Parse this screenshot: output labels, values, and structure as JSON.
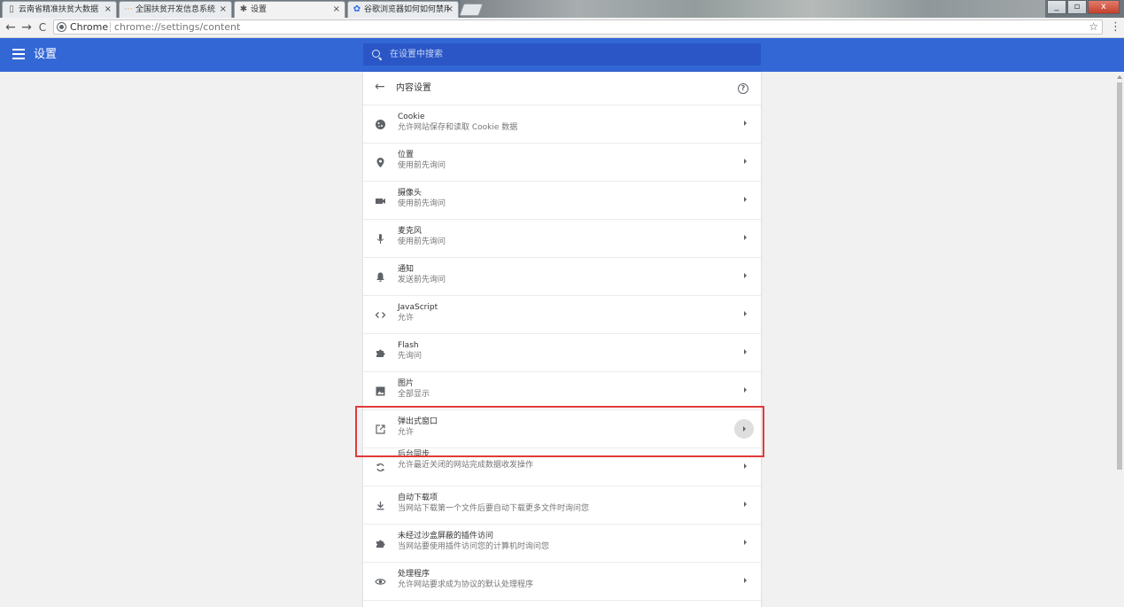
{
  "tabs": [
    {
      "title": "云南省精准扶贫大数据",
      "icon": "document-icon",
      "close": "×"
    },
    {
      "title": "全国扶贫开发信息系统",
      "icon": "page-icon",
      "close": "×"
    },
    {
      "title": "设置",
      "icon": "gear-icon",
      "close": "×"
    },
    {
      "title": "谷歌浏览器如何如何禁用",
      "icon": "baidu-icon",
      "close": "×"
    }
  ],
  "window_controls": {
    "minimize": "_",
    "restore": "▫",
    "close": "x"
  },
  "toolbar": {
    "back": "←",
    "forward": "→",
    "reload": "C",
    "origin_chip": "Chrome",
    "url": "chrome://settings/content",
    "star": "☆",
    "menu": "⋮"
  },
  "header": {
    "title": "设置",
    "search_placeholder": "在设置中搜索"
  },
  "content": {
    "title": "内容设置",
    "help": "?",
    "back": "←",
    "rows": [
      {
        "id": "cookie",
        "icon": "cookie-icon",
        "label": "Cookie",
        "sub": "允许网站保存和读取 Cookie 数据"
      },
      {
        "id": "location",
        "icon": "location-icon",
        "label": "位置",
        "sub": "使用前先询问"
      },
      {
        "id": "camera",
        "icon": "camera-icon",
        "label": "摄像头",
        "sub": "使用前先询问"
      },
      {
        "id": "microphone",
        "icon": "microphone-icon",
        "label": "麦克风",
        "sub": "使用前先询问"
      },
      {
        "id": "notifications",
        "icon": "bell-icon",
        "label": "通知",
        "sub": "发送前先询问"
      },
      {
        "id": "javascript",
        "icon": "code-icon",
        "label": "JavaScript",
        "sub": "允许"
      },
      {
        "id": "flash",
        "icon": "puzzle-icon",
        "label": "Flash",
        "sub": "先询问"
      },
      {
        "id": "images",
        "icon": "image-icon",
        "label": "图片",
        "sub": "全部显示"
      },
      {
        "id": "popups",
        "icon": "open-in-new-icon",
        "label": "弹出式窗口",
        "sub": "允许"
      },
      {
        "id": "background-sync",
        "icon": "sync-icon",
        "label": "后台同步",
        "sub": "允许最近关闭的网站完成数据收发操作"
      },
      {
        "id": "auto-downloads",
        "icon": "download-icon",
        "label": "自动下载项",
        "sub": "当网站下载第一个文件后要自动下载更多文件时询问您"
      },
      {
        "id": "unsandboxed-plugins",
        "icon": "puzzle-icon",
        "label": "未经过沙盒屏蔽的插件访问",
        "sub": "当网站要使用插件访问您的计算机时询问您"
      },
      {
        "id": "handlers",
        "icon": "handler-icon",
        "label": "处理程序",
        "sub": "允许网站要求成为协议的默认处理程序"
      }
    ]
  },
  "colors": {
    "header_blue": "#3367d6",
    "search_blue": "#2a56c6",
    "highlight_red": "#e03b3b"
  }
}
